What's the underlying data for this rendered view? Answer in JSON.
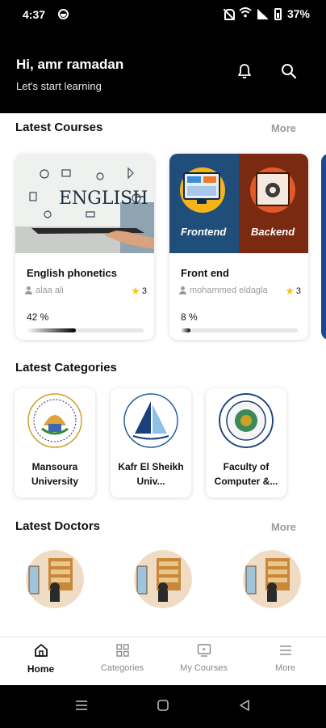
{
  "status": {
    "time": "4:37",
    "battery": "37%"
  },
  "header": {
    "greeting": "Hi, amr ramadan",
    "subtitle": "Let's start learning"
  },
  "latest_courses": {
    "title": "Latest Courses",
    "more": "More",
    "items": [
      {
        "name": "English phonetics",
        "author": "alaa ali",
        "rating": "3",
        "progress_text": "42 %",
        "progress": 0.42,
        "image_text": "ENGLISH"
      },
      {
        "name": "Front end",
        "author": "mohammed eldagla",
        "rating": "3",
        "progress_text": "8 %",
        "progress": 0.08,
        "image_labels": [
          "Frontend",
          "Backend"
        ]
      }
    ]
  },
  "latest_categories": {
    "title": "Latest Categories",
    "items": [
      {
        "name": "Mansoura University"
      },
      {
        "name": "Kafr El Sheikh Univ..."
      },
      {
        "name": "Faculty of Computer &..."
      }
    ]
  },
  "latest_doctors": {
    "title": "Latest Doctors",
    "more": "More",
    "count": 3
  },
  "bottom_nav": [
    {
      "label": "Home",
      "icon": "home-icon",
      "active": true
    },
    {
      "label": "Categories",
      "icon": "grid-icon",
      "active": false
    },
    {
      "label": "My Courses",
      "icon": "monitor-icon",
      "active": false
    },
    {
      "label": "More",
      "icon": "menu-icon",
      "active": false
    }
  ]
}
